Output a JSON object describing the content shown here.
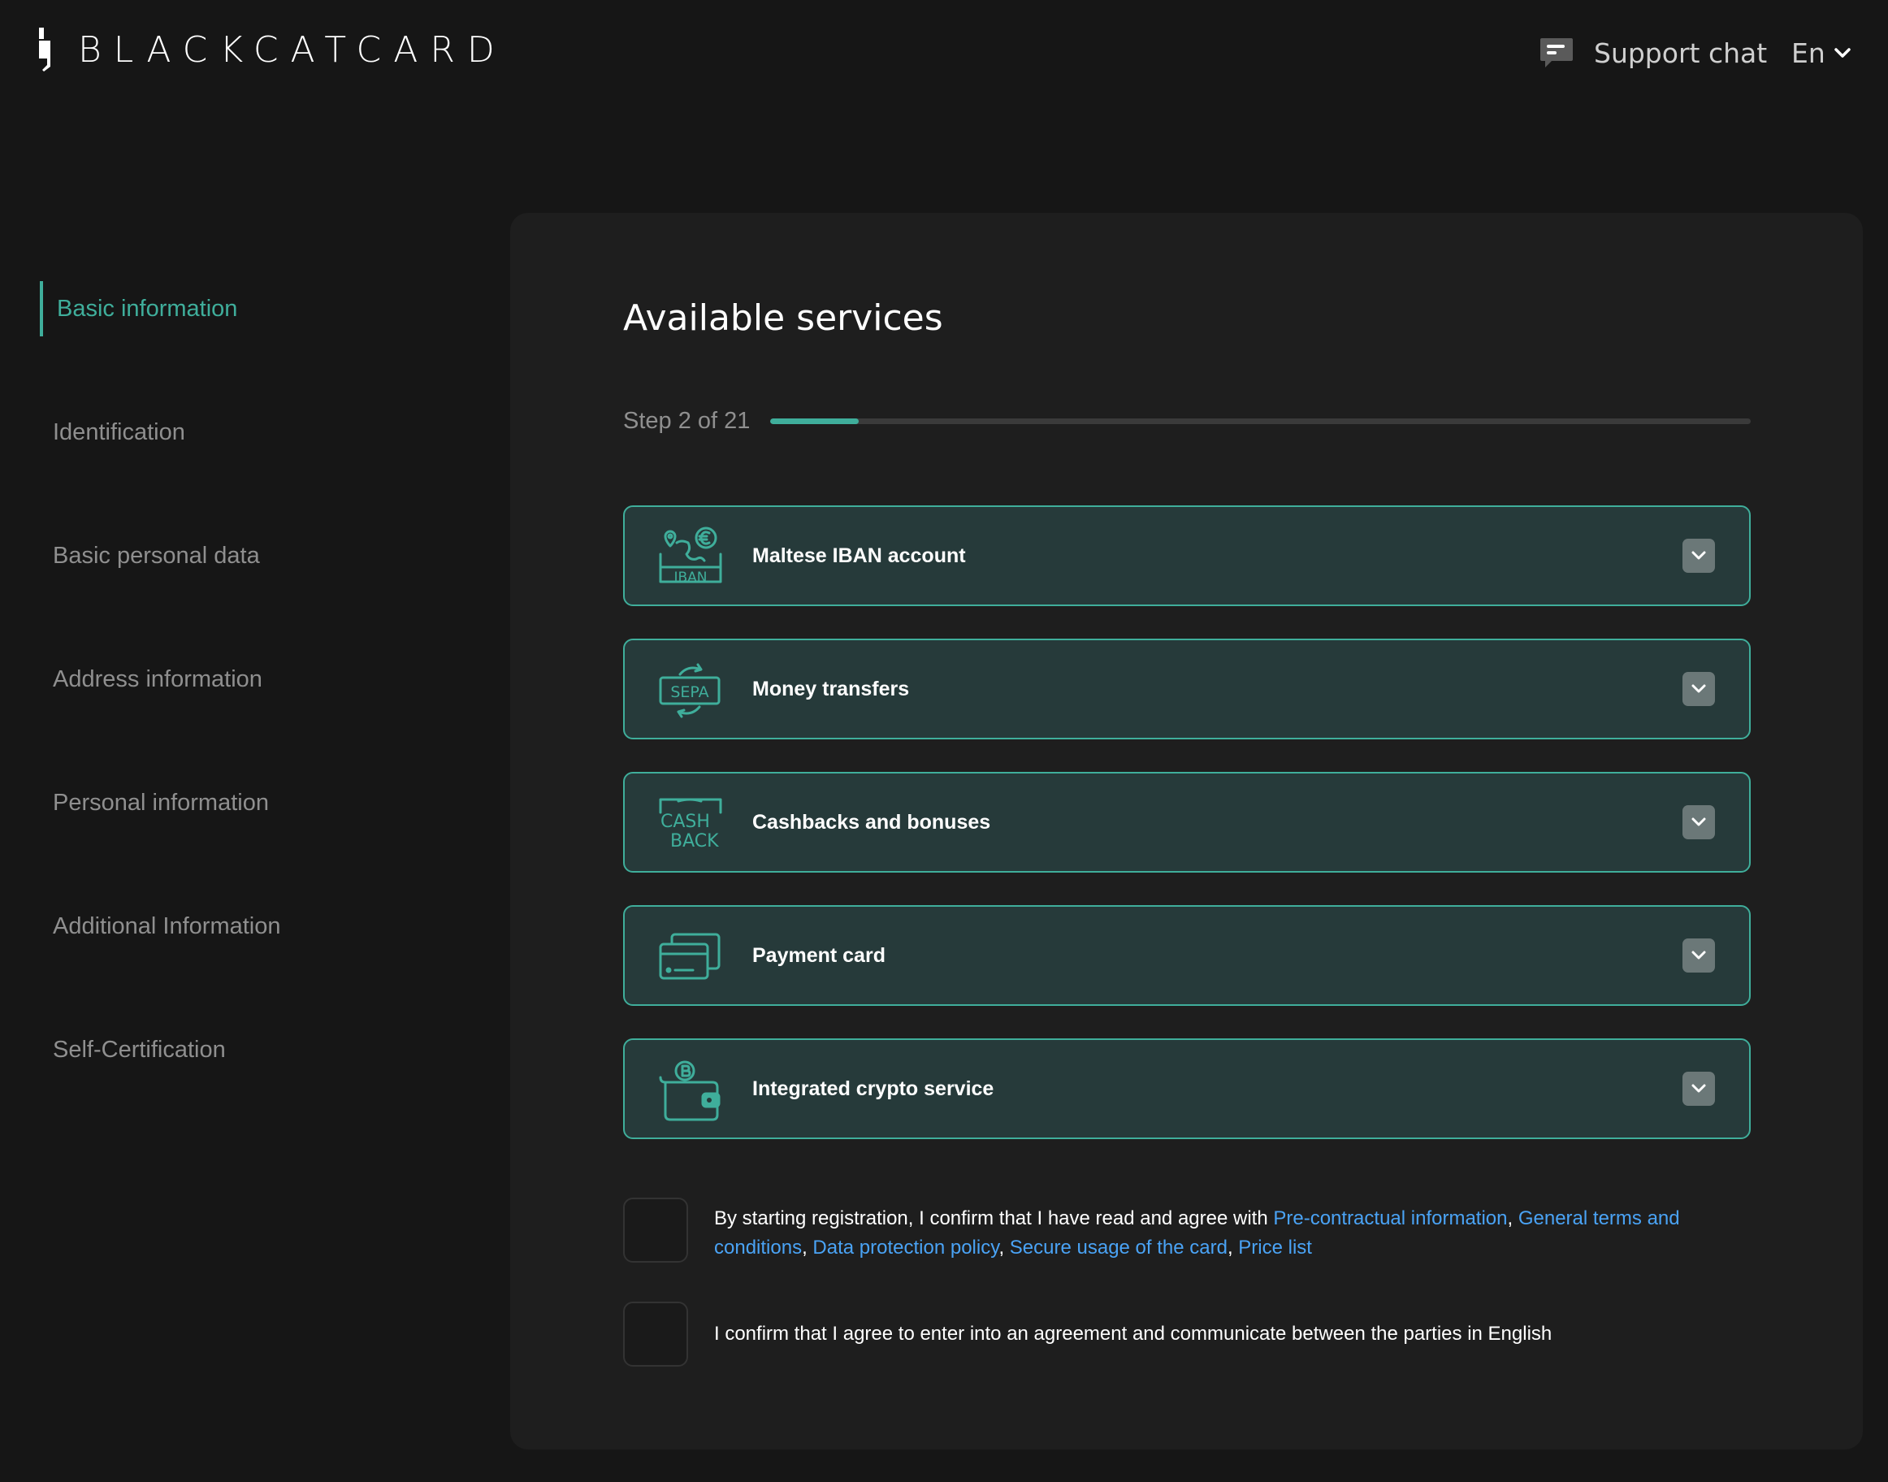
{
  "header": {
    "logo_text": "BLACKCATCARD",
    "support_label": "Support chat",
    "language": "En"
  },
  "sidebar": {
    "items": [
      {
        "label": "Basic information",
        "active": true
      },
      {
        "label": "Identification"
      },
      {
        "label": "Basic personal data"
      },
      {
        "label": "Address information"
      },
      {
        "label": "Personal information"
      },
      {
        "label": "Additional Information"
      },
      {
        "label": "Self-Certification"
      }
    ]
  },
  "main": {
    "title": "Available services",
    "step": {
      "label": "Step 2 of 21",
      "current": 2,
      "total": 21,
      "progress_fraction": 0.09
    },
    "services": [
      {
        "label": "Maltese IBAN account",
        "icon": "iban-icon",
        "icon_text": "IBAN"
      },
      {
        "label": "Money transfers",
        "icon": "sepa-icon",
        "icon_text": "SEPA"
      },
      {
        "label": "Cashbacks and bonuses",
        "icon": "cashback-icon",
        "icon_text": [
          "CASH",
          "BACK"
        ]
      },
      {
        "label": "Payment card",
        "icon": "payment-card-icon"
      },
      {
        "label": "Integrated crypto service",
        "icon": "crypto-wallet-icon"
      }
    ],
    "agreements": {
      "terms": {
        "prefix": "By starting registration, I confirm that I have read and agree with ",
        "links": [
          "Pre-contractual information",
          "General terms and conditions",
          "Data protection policy",
          "Secure usage of the card",
          "Price list"
        ],
        "separator": ", ",
        "checked": false
      },
      "language": {
        "text": "I confirm that I agree to enter into an agreement and communicate between the parties in English",
        "checked": false
      }
    }
  },
  "colors": {
    "accent": "#3fae9b",
    "background": "#161616",
    "card": "#1e1e1e",
    "service_bg": "#263a3a",
    "link": "#4aa3f5"
  }
}
